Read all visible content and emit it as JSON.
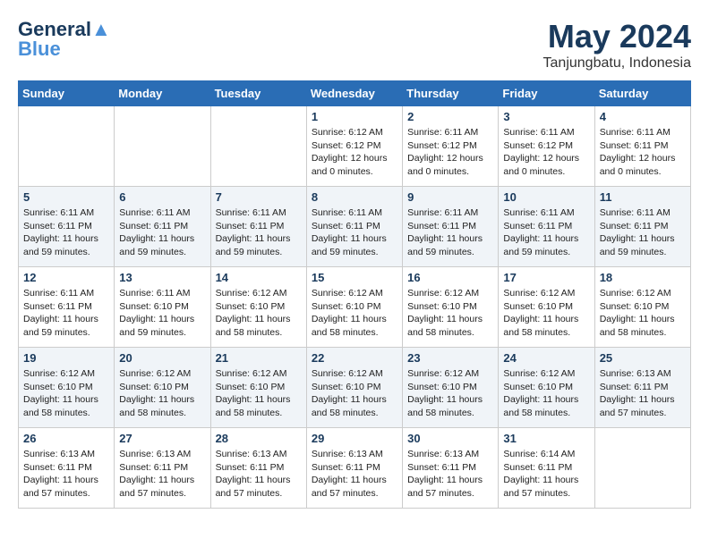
{
  "header": {
    "logo_line1": "General",
    "logo_line2": "Blue",
    "month": "May 2024",
    "location": "Tanjungbatu, Indonesia"
  },
  "weekdays": [
    "Sunday",
    "Monday",
    "Tuesday",
    "Wednesday",
    "Thursday",
    "Friday",
    "Saturday"
  ],
  "weeks": [
    [
      {
        "day": "",
        "info": ""
      },
      {
        "day": "",
        "info": ""
      },
      {
        "day": "",
        "info": ""
      },
      {
        "day": "1",
        "info": "Sunrise: 6:12 AM\nSunset: 6:12 PM\nDaylight: 12 hours\nand 0 minutes."
      },
      {
        "day": "2",
        "info": "Sunrise: 6:11 AM\nSunset: 6:12 PM\nDaylight: 12 hours\nand 0 minutes."
      },
      {
        "day": "3",
        "info": "Sunrise: 6:11 AM\nSunset: 6:12 PM\nDaylight: 12 hours\nand 0 minutes."
      },
      {
        "day": "4",
        "info": "Sunrise: 6:11 AM\nSunset: 6:11 PM\nDaylight: 12 hours\nand 0 minutes."
      }
    ],
    [
      {
        "day": "5",
        "info": "Sunrise: 6:11 AM\nSunset: 6:11 PM\nDaylight: 11 hours\nand 59 minutes."
      },
      {
        "day": "6",
        "info": "Sunrise: 6:11 AM\nSunset: 6:11 PM\nDaylight: 11 hours\nand 59 minutes."
      },
      {
        "day": "7",
        "info": "Sunrise: 6:11 AM\nSunset: 6:11 PM\nDaylight: 11 hours\nand 59 minutes."
      },
      {
        "day": "8",
        "info": "Sunrise: 6:11 AM\nSunset: 6:11 PM\nDaylight: 11 hours\nand 59 minutes."
      },
      {
        "day": "9",
        "info": "Sunrise: 6:11 AM\nSunset: 6:11 PM\nDaylight: 11 hours\nand 59 minutes."
      },
      {
        "day": "10",
        "info": "Sunrise: 6:11 AM\nSunset: 6:11 PM\nDaylight: 11 hours\nand 59 minutes."
      },
      {
        "day": "11",
        "info": "Sunrise: 6:11 AM\nSunset: 6:11 PM\nDaylight: 11 hours\nand 59 minutes."
      }
    ],
    [
      {
        "day": "12",
        "info": "Sunrise: 6:11 AM\nSunset: 6:11 PM\nDaylight: 11 hours\nand 59 minutes."
      },
      {
        "day": "13",
        "info": "Sunrise: 6:11 AM\nSunset: 6:10 PM\nDaylight: 11 hours\nand 59 minutes."
      },
      {
        "day": "14",
        "info": "Sunrise: 6:12 AM\nSunset: 6:10 PM\nDaylight: 11 hours\nand 58 minutes."
      },
      {
        "day": "15",
        "info": "Sunrise: 6:12 AM\nSunset: 6:10 PM\nDaylight: 11 hours\nand 58 minutes."
      },
      {
        "day": "16",
        "info": "Sunrise: 6:12 AM\nSunset: 6:10 PM\nDaylight: 11 hours\nand 58 minutes."
      },
      {
        "day": "17",
        "info": "Sunrise: 6:12 AM\nSunset: 6:10 PM\nDaylight: 11 hours\nand 58 minutes."
      },
      {
        "day": "18",
        "info": "Sunrise: 6:12 AM\nSunset: 6:10 PM\nDaylight: 11 hours\nand 58 minutes."
      }
    ],
    [
      {
        "day": "19",
        "info": "Sunrise: 6:12 AM\nSunset: 6:10 PM\nDaylight: 11 hours\nand 58 minutes."
      },
      {
        "day": "20",
        "info": "Sunrise: 6:12 AM\nSunset: 6:10 PM\nDaylight: 11 hours\nand 58 minutes."
      },
      {
        "day": "21",
        "info": "Sunrise: 6:12 AM\nSunset: 6:10 PM\nDaylight: 11 hours\nand 58 minutes."
      },
      {
        "day": "22",
        "info": "Sunrise: 6:12 AM\nSunset: 6:10 PM\nDaylight: 11 hours\nand 58 minutes."
      },
      {
        "day": "23",
        "info": "Sunrise: 6:12 AM\nSunset: 6:10 PM\nDaylight: 11 hours\nand 58 minutes."
      },
      {
        "day": "24",
        "info": "Sunrise: 6:12 AM\nSunset: 6:10 PM\nDaylight: 11 hours\nand 58 minutes."
      },
      {
        "day": "25",
        "info": "Sunrise: 6:13 AM\nSunset: 6:11 PM\nDaylight: 11 hours\nand 57 minutes."
      }
    ],
    [
      {
        "day": "26",
        "info": "Sunrise: 6:13 AM\nSunset: 6:11 PM\nDaylight: 11 hours\nand 57 minutes."
      },
      {
        "day": "27",
        "info": "Sunrise: 6:13 AM\nSunset: 6:11 PM\nDaylight: 11 hours\nand 57 minutes."
      },
      {
        "day": "28",
        "info": "Sunrise: 6:13 AM\nSunset: 6:11 PM\nDaylight: 11 hours\nand 57 minutes."
      },
      {
        "day": "29",
        "info": "Sunrise: 6:13 AM\nSunset: 6:11 PM\nDaylight: 11 hours\nand 57 minutes."
      },
      {
        "day": "30",
        "info": "Sunrise: 6:13 AM\nSunset: 6:11 PM\nDaylight: 11 hours\nand 57 minutes."
      },
      {
        "day": "31",
        "info": "Sunrise: 6:14 AM\nSunset: 6:11 PM\nDaylight: 11 hours\nand 57 minutes."
      },
      {
        "day": "",
        "info": ""
      }
    ]
  ]
}
